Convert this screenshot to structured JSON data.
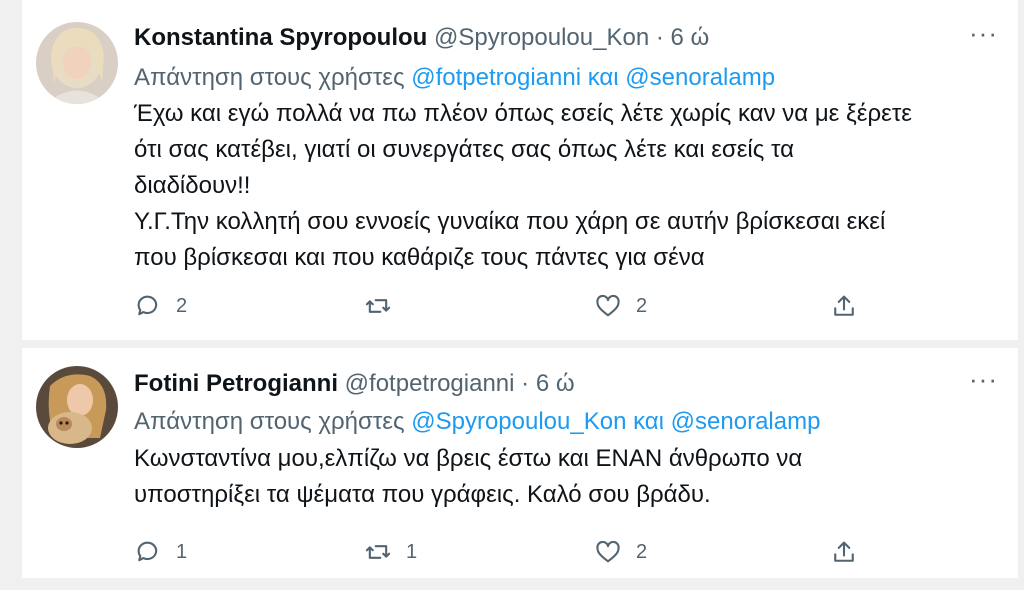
{
  "tweets": [
    {
      "author_name": "Konstantina Spyropoulou",
      "handle": "@Spyropoulou_Kon",
      "dot": "·",
      "time": "6 ώ",
      "more": "···",
      "reply_prefix": "Απάντηση στους χρήστες",
      "reply_mentions": "@fotpetrogianni και @senoralamp",
      "text_lines": [
        "Έχω και εγώ πολλά να πω πλέον όπως εσείς λέτε χωρίς καν να με ξέρετε",
        "ότι σας κατέβει, γιατί οι συνεργάτες σας όπως λέτε και εσείς τα",
        "διαδίδουν!!",
        "Υ.Γ.Την κολλητή σου εννοείς γυναίκα που χάρη σε αυτήν βρίσκεσαι εκεί",
        "που βρίσκεσαι και που καθάριζε τους πάντες για σένα"
      ],
      "reply_count": "2",
      "retweet_count": "",
      "like_count": "2"
    },
    {
      "author_name": "Fotini Petrogianni",
      "handle": "@fotpetrogianni",
      "dot": "·",
      "time": "6 ώ",
      "more": "···",
      "reply_prefix": "Απάντηση στους χρήστες",
      "reply_mentions": "@Spyropoulou_Kon και @senoralamp",
      "text_lines": [
        "Κωνσταντίνα μου,ελπίζω να βρεις έστω και ΕΝΑΝ άνθρωπο να",
        "υποστηρίξει τα ψέματα που γράφεις. Καλό σου βράδυ."
      ],
      "reply_count": "1",
      "retweet_count": "1",
      "like_count": "2"
    }
  ],
  "colors": {
    "link": "#1d9bf0",
    "secondary_text": "#536471",
    "primary_text": "#0f1419",
    "background": "#f0f0f0",
    "card": "#ffffff"
  },
  "icons": {
    "reply": "reply-bubble-icon",
    "retweet": "retweet-arrows-icon",
    "like": "heart-icon",
    "share": "share-upload-icon",
    "more": "more-dots-icon"
  }
}
